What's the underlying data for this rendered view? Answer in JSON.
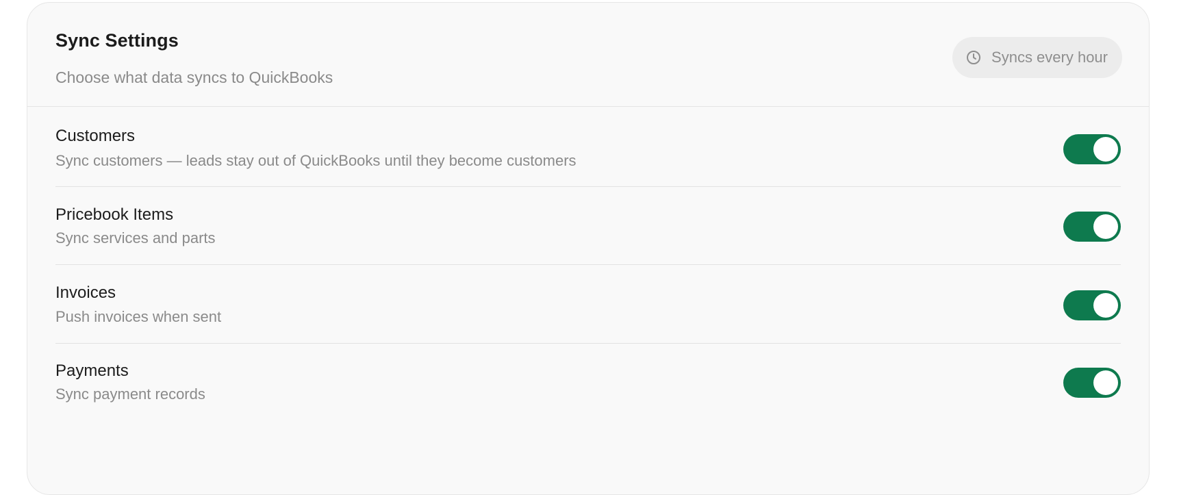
{
  "header": {
    "title": "Sync Settings",
    "subtitle": "Choose what data syncs to QuickBooks",
    "sync_frequency": "Syncs every hour",
    "sync_icon": "clock-icon"
  },
  "settings": [
    {
      "title": "Customers",
      "description": "Sync customers — leads stay out of QuickBooks until they become customers",
      "enabled": true
    },
    {
      "title": "Pricebook Items",
      "description": "Sync services and parts",
      "enabled": true
    },
    {
      "title": "Invoices",
      "description": "Push invoices when sent",
      "enabled": true
    },
    {
      "title": "Payments",
      "description": "Sync payment records",
      "enabled": true
    }
  ],
  "colors": {
    "toggle_on": "#0e7a4e",
    "card_background": "#f9f9f9",
    "pill_background": "#ececec"
  }
}
